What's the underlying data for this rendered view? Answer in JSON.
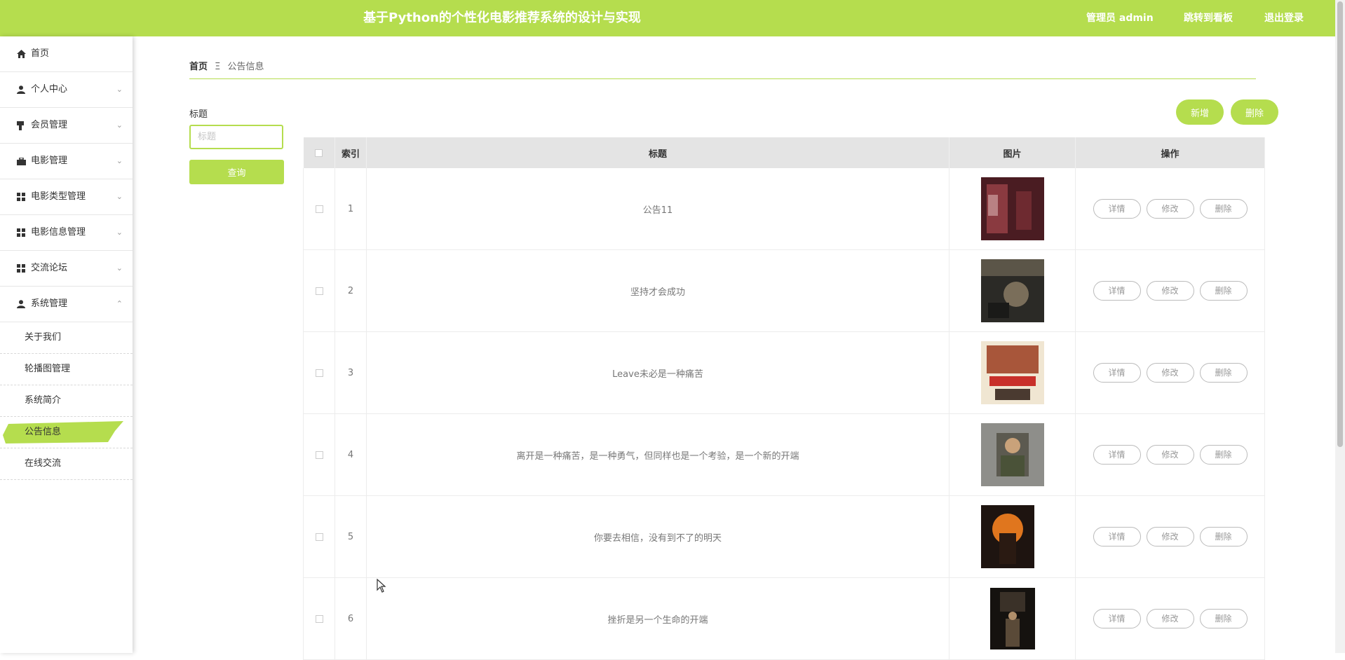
{
  "header": {
    "title": "基于Python的个性化电影推荐系统的设计与实现",
    "admin": "管理员 admin",
    "goto_board": "跳转到看板",
    "logout": "退出登录"
  },
  "sidebar": {
    "items": [
      {
        "label": "首页",
        "icon": "home-icon"
      },
      {
        "label": "个人中心",
        "icon": "user-icon"
      },
      {
        "label": "会员管理",
        "icon": "member-icon"
      },
      {
        "label": "电影管理",
        "icon": "briefcase-icon"
      },
      {
        "label": "电影类型管理",
        "icon": "grid-icon"
      },
      {
        "label": "电影信息管理",
        "icon": "grid-icon"
      },
      {
        "label": "交流论坛",
        "icon": "grid-icon"
      },
      {
        "label": "系统管理",
        "icon": "user-icon"
      }
    ],
    "sub_items": [
      "关于我们",
      "轮播图管理",
      "系统简介",
      "公告信息",
      "在线交流"
    ],
    "active_sub": "公告信息"
  },
  "breadcrumb": {
    "home": "首页",
    "separator": "Ξ",
    "current": "公告信息"
  },
  "search": {
    "label": "标题",
    "placeholder": "标题",
    "value": "",
    "button": "查询"
  },
  "actions": {
    "add": "新增",
    "delete": "删除"
  },
  "table": {
    "headers": {
      "index": "索引",
      "title": "标题",
      "image": "图片",
      "ops": "操作"
    },
    "op_labels": {
      "detail": "详情",
      "edit": "修改",
      "delete": "删除"
    },
    "rows": [
      {
        "index": "1",
        "title": "公告11"
      },
      {
        "index": "2",
        "title": "坚持才会成功"
      },
      {
        "index": "3",
        "title": "Leave未必是一种痛苦"
      },
      {
        "index": "4",
        "title": "离开是一种痛苦，是一种勇气，但同样也是一个考验，是一个新的开端"
      },
      {
        "index": "5",
        "title": "你要去相信，没有到不了的明天"
      },
      {
        "index": "6",
        "title": "挫折是另一个生命的开端"
      }
    ]
  },
  "colors": {
    "accent": "#b5dd4e"
  }
}
